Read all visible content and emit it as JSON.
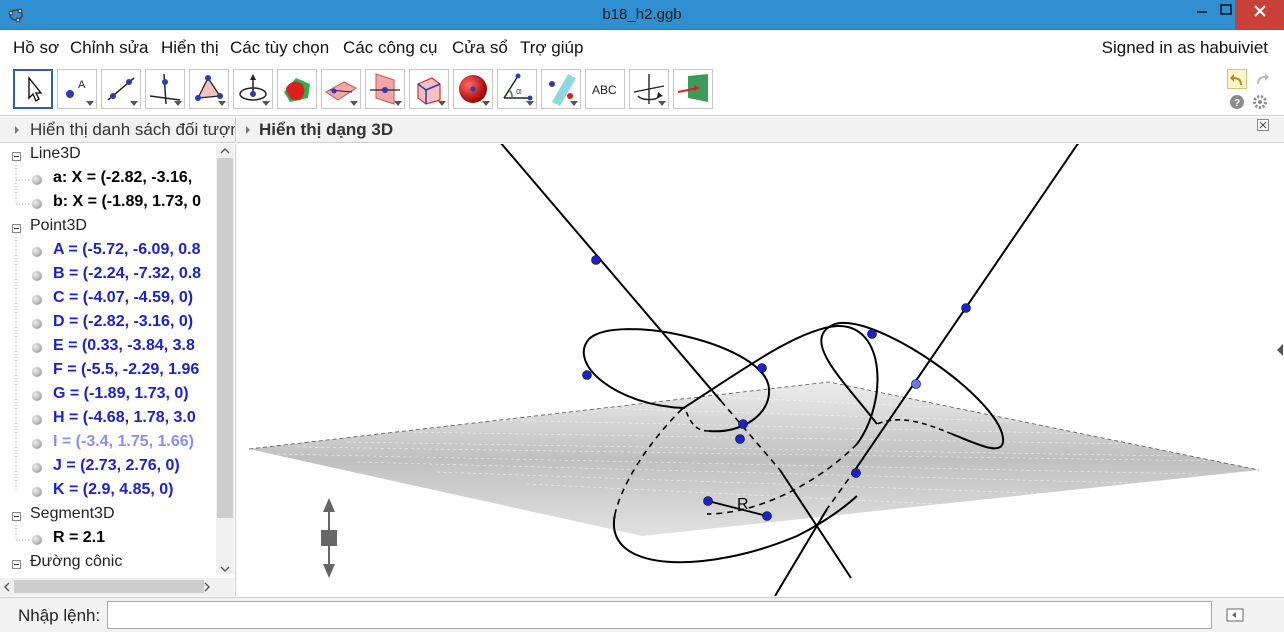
{
  "window": {
    "title": "b18_h2.ggb"
  },
  "menu": {
    "items": [
      "Hồ sơ",
      "Chỉnh sửa",
      "Hiển thị",
      "Các tùy chọn",
      "Các công cụ",
      "Cửa sổ",
      "Trợ giúp"
    ],
    "signed_in": "Signed in as habuiviet"
  },
  "toolbar": {
    "tools": [
      {
        "icon": "move-arrow-icon"
      },
      {
        "icon": "point-icon"
      },
      {
        "icon": "line-icon"
      },
      {
        "icon": "perpendicular-line-icon"
      },
      {
        "icon": "polygon-icon"
      },
      {
        "icon": "circle-axis-icon"
      },
      {
        "icon": "intersect-surfaces-icon"
      },
      {
        "icon": "plane-three-points-icon"
      },
      {
        "icon": "perpendicular-plane-icon"
      },
      {
        "icon": "pyramid-icon"
      },
      {
        "icon": "sphere-icon"
      },
      {
        "icon": "angle-icon"
      },
      {
        "icon": "reflect-plane-icon"
      },
      {
        "icon": "text-icon",
        "label": "ABC"
      },
      {
        "icon": "rotate-view-icon"
      },
      {
        "icon": "view-in-front-icon"
      }
    ],
    "undo": "undo-icon",
    "redo": "redo-icon",
    "help": "help-icon",
    "settings": "gear-icon"
  },
  "algebra": {
    "header": "Hiển thị danh sách đối tượng",
    "categories": [
      {
        "name": "Line3D",
        "items": [
          {
            "text": "a: X = (-2.82, -3.16,",
            "color": "#000000"
          },
          {
            "text": "b: X = (-1.89, 1.73, 0",
            "color": "#000000"
          }
        ]
      },
      {
        "name": "Point3D",
        "items": [
          {
            "text": "A = (-5.72, -6.09, 0.8",
            "color": "#1a22cc"
          },
          {
            "text": "B = (-2.24, -7.32, 0.8",
            "color": "#1a22cc"
          },
          {
            "text": "C = (-4.07, -4.59, 0)",
            "color": "#1a22cc"
          },
          {
            "text": "D = (-2.82, -3.16, 0)",
            "color": "#1a22cc"
          },
          {
            "text": "E = (0.33, -3.84, 3.8",
            "color": "#1a22cc"
          },
          {
            "text": "F = (-5.5, -2.29, 1.96",
            "color": "#1a22cc"
          },
          {
            "text": "G = (-1.89, 1.73, 0)",
            "color": "#1a22cc"
          },
          {
            "text": "H = (-4.68, 1.78, 3.0",
            "color": "#1a22cc"
          },
          {
            "text": "I = (-3.4, 1.75, 1.66)",
            "color": "#8a8ef0"
          },
          {
            "text": "J = (2.73, 2.76, 0)",
            "color": "#1a22cc"
          },
          {
            "text": "K = (2.9, 4.85, 0)",
            "color": "#1a22cc"
          }
        ]
      },
      {
        "name": "Segment3D",
        "items": [
          {
            "text": "R = 2.1",
            "color": "#000000"
          }
        ]
      },
      {
        "name": "Đường cônic",
        "items": []
      }
    ]
  },
  "view3d": {
    "header": "Hiển thị dạng 3D",
    "label_R": "R"
  },
  "inputbar": {
    "label": "Nhập lệnh:",
    "value": ""
  }
}
